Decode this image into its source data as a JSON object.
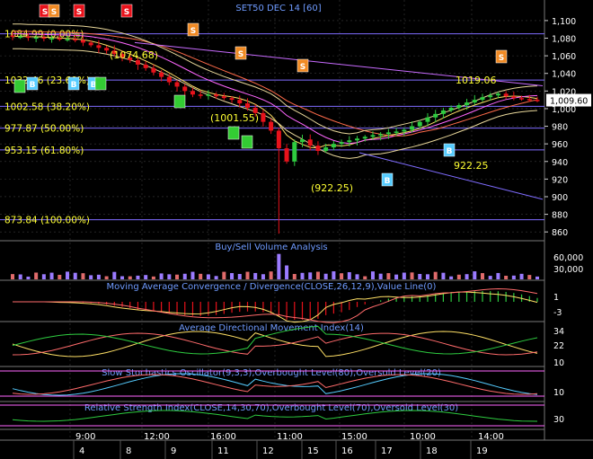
{
  "title": "SET50 DEC 14   [60]",
  "colors": {
    "bg": "#000000",
    "grid": "#3a3a3a",
    "axis_text": "#ffffff",
    "panel_title": "#6f9bff",
    "fib_label": "#ffff33",
    "fib_line": "#7f6cff",
    "up_candle": "#2ecc40",
    "down_candle": "#e8121b",
    "price_tag_bg": "#ffffff",
    "price_tag_text": "#000000",
    "signal_buy": "#33cc33",
    "signal_b": "#55ccff",
    "signal_s_red": "#e8121b",
    "signal_s_orange": "#f08a24"
  },
  "price_axis": {
    "ticks": [
      "1,100",
      "1,080",
      "1,060",
      "1,040",
      "1,020",
      "1,000",
      "980",
      "960",
      "940",
      "920",
      "900",
      "880",
      "860"
    ],
    "last_price": "1,009.60"
  },
  "fib_levels": [
    {
      "label": "1084.99 (0.00%)",
      "price": 1084.99
    },
    {
      "label": "1032.46 (23.60%)",
      "price": 1032.46
    },
    {
      "label": "1002.58 (38.20%)",
      "price": 1002.58
    },
    {
      "label": "977.87 (50.00%)",
      "price": 977.87
    },
    {
      "label": "953.15 (61.80%)",
      "price": 953.15
    },
    {
      "label": "873.84 (100.00%)",
      "price": 873.84
    }
  ],
  "price_annotations": [
    {
      "label": "(1074.68)"
    },
    {
      "label": "(1001.55)"
    },
    {
      "label": "(922.25)"
    },
    {
      "label": "922.25"
    },
    {
      "label": "1019.06"
    }
  ],
  "signals": {
    "s_label": "S",
    "b_label": "B"
  },
  "panels": {
    "volume": {
      "title": "Buy/Sell Volume Analysis",
      "ticks": [
        "60,000",
        "30,000"
      ]
    },
    "macd": {
      "title": "Moving Average Convergence / Divergence(CLOSE,26,12,9),Value Line(0)",
      "ticks": [
        "1",
        "-3"
      ]
    },
    "adx": {
      "title": "Average Directional Movement Index(14)",
      "ticks": [
        "34",
        "22",
        "10"
      ]
    },
    "stoch": {
      "title": "Slow Stochastics Oscillator(9,3,3),Overbought Level(80),Oversold Level(20)",
      "ticks": [
        "10"
      ]
    },
    "rsi": {
      "title": "Relative Strength Index(CLOSE,14,30,70),Overbought Level(70),Oversold Level(30)",
      "ticks": [
        "30"
      ]
    }
  },
  "time_axis": {
    "times": [
      {
        "label": "9:00"
      },
      {
        "label": "12:00"
      },
      {
        "label": "16:00"
      },
      {
        "label": "11:00"
      },
      {
        "label": "15:00"
      },
      {
        "label": "10:00"
      },
      {
        "label": "14:00"
      }
    ],
    "dates": [
      "4",
      "8",
      "9",
      "11",
      "12",
      "15",
      "16",
      "17",
      "18",
      "19"
    ]
  },
  "chart_data": {
    "type": "candlestick",
    "title": "SET50 DEC 14   [60]",
    "y_range": [
      850,
      1105
    ],
    "close_series": [
      1082,
      1082,
      1081,
      1081,
      1080,
      1080,
      1079,
      1079,
      1078,
      1075,
      1072,
      1069,
      1066,
      1062,
      1058,
      1055,
      1050,
      1046,
      1041,
      1036,
      1030,
      1025,
      1020,
      1016,
      1015,
      1016,
      1014,
      1012,
      1010,
      1006,
      1001,
      995,
      985,
      975,
      955,
      940,
      962,
      965,
      958,
      952,
      956,
      960,
      962,
      964,
      966,
      968,
      970,
      971,
      973,
      974,
      976,
      980,
      985,
      990,
      994,
      998,
      1001,
      1004,
      1007,
      1010,
      1013,
      1015,
      1017,
      1014,
      1012,
      1011,
      1010,
      1009.6
    ]
  }
}
